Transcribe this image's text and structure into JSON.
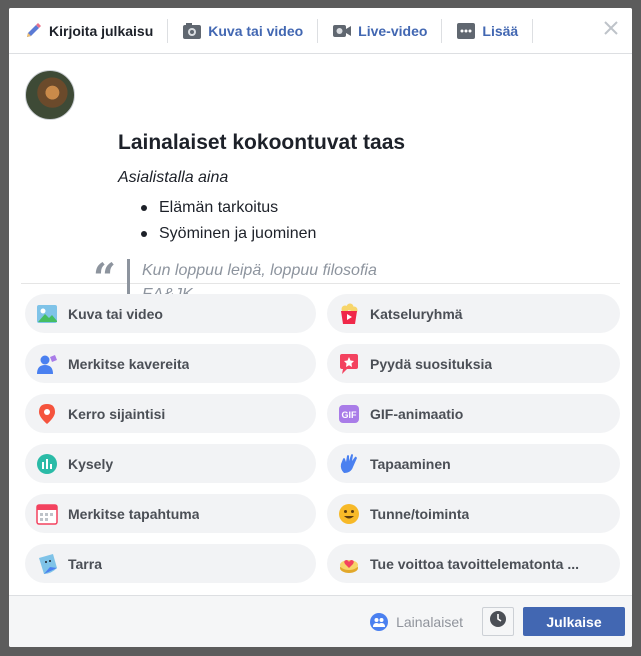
{
  "tabs": [
    {
      "label": "Kirjoita julkaisu",
      "icon": "pencil-icon"
    },
    {
      "label": "Kuva tai video",
      "icon": "camera-icon"
    },
    {
      "label": "Live-video",
      "icon": "video-camera-icon"
    },
    {
      "label": "Lisää",
      "icon": "more-icon"
    }
  ],
  "post": {
    "title": "Lainalaiset kokoontuvat taas",
    "subtitle": "Asialistalla aina",
    "list": [
      "Elämän tarkoitus",
      "Syöminen ja juominen"
    ],
    "quote_lines": [
      "Kun loppuu leipä, loppuu filosofia",
      "EA&JK"
    ]
  },
  "actions": [
    {
      "label": "Kuva tai video",
      "icon": "photo-icon"
    },
    {
      "label": "Katseluryhmä",
      "icon": "popcorn-icon"
    },
    {
      "label": "Merkitse kavereita",
      "icon": "tag-friends-icon"
    },
    {
      "label": "Pyydä suosituksia",
      "icon": "recommendation-icon"
    },
    {
      "label": "Kerro sijaintisi",
      "icon": "location-pin-icon"
    },
    {
      "label": "GIF-animaatio",
      "icon": "gif-icon"
    },
    {
      "label": "Kysely",
      "icon": "poll-icon"
    },
    {
      "label": "Tapaaminen",
      "icon": "wave-hand-icon"
    },
    {
      "label": "Merkitse tapahtuma",
      "icon": "calendar-icon"
    },
    {
      "label": "Tunne/toiminta",
      "icon": "smiley-icon"
    },
    {
      "label": "Tarra",
      "icon": "sticker-icon"
    },
    {
      "label": "Tue voittoa tavoittelematonta ...",
      "icon": "donate-icon"
    }
  ],
  "footer": {
    "audience": "Lainalaiset",
    "publish": "Julkaise"
  },
  "colors": {
    "brand": "#4267b2",
    "text": "#1d2129",
    "muted": "#90949c"
  }
}
